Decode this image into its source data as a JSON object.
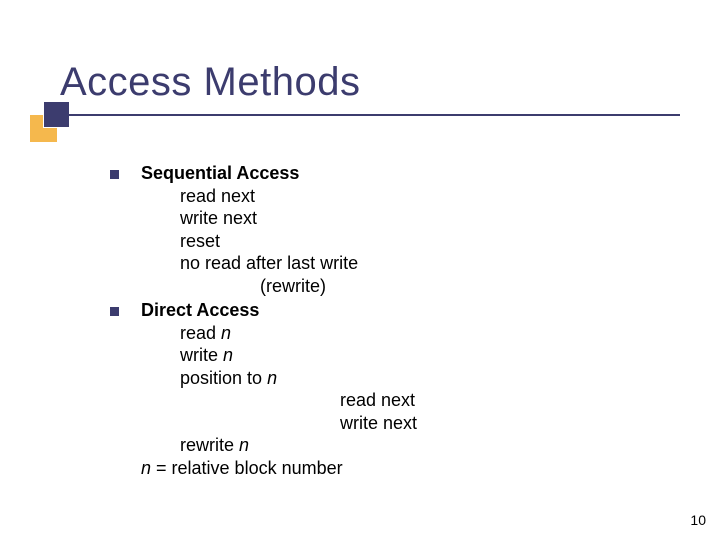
{
  "title": "Access Methods",
  "bullets": [
    {
      "heading": "Sequential Access",
      "lines": [
        {
          "indent": 1,
          "segments": [
            {
              "t": "read next"
            }
          ]
        },
        {
          "indent": 1,
          "segments": [
            {
              "t": "write next"
            }
          ]
        },
        {
          "indent": 1,
          "segments": [
            {
              "t": "reset"
            }
          ]
        },
        {
          "indent": 1,
          "segments": [
            {
              "t": "no read after last write"
            }
          ]
        },
        {
          "indent": 2,
          "segments": [
            {
              "t": "(rewrite)"
            }
          ]
        }
      ]
    },
    {
      "heading": "Direct Access",
      "lines": [
        {
          "indent": 1,
          "segments": [
            {
              "t": "read "
            },
            {
              "t": "n",
              "it": true
            }
          ]
        },
        {
          "indent": 1,
          "segments": [
            {
              "t": "write "
            },
            {
              "t": "n",
              "it": true
            }
          ]
        },
        {
          "indent": 1,
          "segments": [
            {
              "t": "position to "
            },
            {
              "t": "n",
              "it": true
            }
          ]
        },
        {
          "indent": 3,
          "segments": [
            {
              "t": "read next"
            }
          ]
        },
        {
          "indent": 3,
          "segments": [
            {
              "t": "write next"
            }
          ]
        },
        {
          "indent": 1,
          "segments": [
            {
              "t": "rewrite "
            },
            {
              "t": "n",
              "it": true
            }
          ]
        },
        {
          "indent": 0,
          "segments": [
            {
              "t": "n ",
              "it": true
            },
            {
              "t": "= relative block number"
            }
          ]
        }
      ]
    }
  ],
  "page_number": "10"
}
